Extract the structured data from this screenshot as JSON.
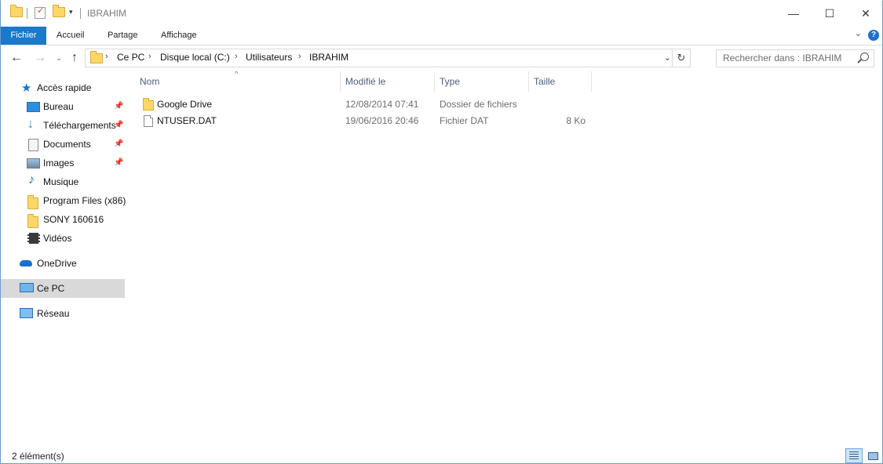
{
  "window": {
    "title": "IBRAHIM",
    "controls": {
      "minimize": "—",
      "maximize": "☐",
      "close": "✕"
    }
  },
  "ribbon": {
    "tabs": [
      {
        "label": "Fichier",
        "active": true
      },
      {
        "label": "Accueil"
      },
      {
        "label": "Partage"
      },
      {
        "label": "Affichage"
      }
    ],
    "help": "?"
  },
  "address": {
    "breadcrumbs": [
      "Ce PC",
      "Disque local (C:)",
      "Utilisateurs",
      "IBRAHIM"
    ],
    "search_placeholder": "Rechercher dans : IBRAHIM"
  },
  "nav_pane": {
    "quick_access": "Accès rapide",
    "quick_items": [
      {
        "label": "Bureau",
        "icon": "desktop-icon",
        "pinned": true
      },
      {
        "label": "Téléchargements",
        "icon": "download-icon",
        "pinned": true
      },
      {
        "label": "Documents",
        "icon": "documents-icon",
        "pinned": true
      },
      {
        "label": "Images",
        "icon": "pictures-icon",
        "pinned": true
      },
      {
        "label": "Musique",
        "icon": "music-icon",
        "pinned": false
      },
      {
        "label": "Program Files (x86)",
        "icon": "folder-icon",
        "pinned": false
      },
      {
        "label": "SONY 160616",
        "icon": "folder-icon",
        "pinned": false
      },
      {
        "label": "Vidéos",
        "icon": "videos-icon",
        "pinned": false
      }
    ],
    "onedrive": "OneDrive",
    "this_pc": "Ce PC",
    "network": "Réseau"
  },
  "columns": {
    "name": "Nom",
    "modified": "Modifié le",
    "type": "Type",
    "size": "Taille"
  },
  "files": [
    {
      "name": "Google Drive",
      "modified": "12/08/2014 07:41",
      "type": "Dossier de fichiers",
      "size": "",
      "icon": "folder-icon"
    },
    {
      "name": "NTUSER.DAT",
      "modified": "19/06/2016 20:46",
      "type": "Fichier DAT",
      "size": "8 Ko",
      "icon": "file-icon"
    }
  ],
  "status": {
    "count": "2 élément(s)"
  },
  "colors": {
    "accent": "#1979ca",
    "selected_nav": "#d9d9d9",
    "folder": "#ffd766"
  }
}
